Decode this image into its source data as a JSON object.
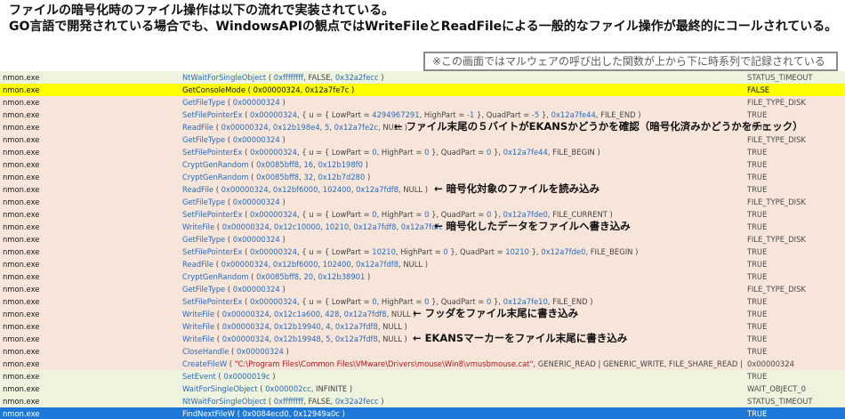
{
  "header": {
    "line1": "ファイルの暗号化時のファイル操作は以下の流れで実装されている。",
    "line2": "GO言語で開発されている場合でも、WindowsAPIの観点ではWriteFileとReadFileによる一般的なファイル操作が最終的にコールされている。"
  },
  "note": "※この画面ではマルウェアの呼び出した関数が上から下に時系列で記録されている",
  "rows": [
    {
      "process": "nmon.exe",
      "func": "NtWaitForSingleObject",
      "args": "( 0xffffffff, FALSE, 0x32a2fecc )",
      "result": "STATUS_TIMEOUT",
      "color": "green"
    },
    {
      "process": "nmon.exe",
      "func": "GetConsoleMode",
      "args": "( 0x00000324, 0x12a7fe7c )",
      "result": "FALSE",
      "color": "yellow"
    },
    {
      "process": "nmon.exe",
      "func": "GetFileType",
      "args": "( 0x00000324 )",
      "result": "FILE_TYPE_DISK",
      "color": "peach"
    },
    {
      "process": "nmon.exe",
      "func": "SetFilePointerEx",
      "args": "( 0x00000324, { u = { LowPart = 4294967291, HighPart = -1 }, QuadPart = -5 }, 0x12a7fe44, FILE_END )",
      "result": "TRUE",
      "color": "peach"
    },
    {
      "process": "nmon.exe",
      "func": "ReadFile",
      "args": "( 0x00000324, 0x12b198e4, 5, 0x12a7fe2c, NULL )",
      "result": "TRUE",
      "color": "peach"
    },
    {
      "process": "nmon.exe",
      "func": "GetFileType",
      "args": "( 0x00000324 )",
      "result": "FILE_TYPE_DISK",
      "color": "peach"
    },
    {
      "process": "nmon.exe",
      "func": "SetFilePointerEx",
      "args": "( 0x00000324, { u = { LowPart = 0, HighPart = 0 }, QuadPart = 0 }, 0x12a7fe44, FILE_BEGIN )",
      "result": "TRUE",
      "color": "peach"
    },
    {
      "process": "nmon.exe",
      "func": "CryptGenRandom",
      "args": "( 0x0085bff8, 16, 0x12b198f0 )",
      "result": "TRUE",
      "color": "peach"
    },
    {
      "process": "nmon.exe",
      "func": "CryptGenRandom",
      "args": "( 0x0085bff8, 32, 0x12b7d280 )",
      "result": "TRUE",
      "color": "peach"
    },
    {
      "process": "nmon.exe",
      "func": "ReadFile",
      "args": "( 0x00000324, 0x12bf6000, 102400, 0x12a7fdf8, NULL )",
      "result": "TRUE",
      "color": "peach"
    },
    {
      "process": "nmon.exe",
      "func": "GetFileType",
      "args": "( 0x00000324 )",
      "result": "FILE_TYPE_DISK",
      "color": "peach"
    },
    {
      "process": "nmon.exe",
      "func": "SetFilePointerEx",
      "args": "( 0x00000324, { u = { LowPart = 0, HighPart = 0 }, QuadPart = 0 }, 0x12a7fde0, FILE_CURRENT )",
      "result": "TRUE",
      "color": "peach"
    },
    {
      "process": "nmon.exe",
      "func": "WriteFile",
      "args": "( 0x00000324, 0x12c10000, 10210, 0x12a7fdf8, 0x12a7fdfc )",
      "result": "TRUE",
      "color": "peach"
    },
    {
      "process": "nmon.exe",
      "func": "GetFileType",
      "args": "( 0x00000324 )",
      "result": "FILE_TYPE_DISK",
      "color": "peach"
    },
    {
      "process": "nmon.exe",
      "func": "SetFilePointerEx",
      "args": "( 0x00000324, { u = { LowPart = 10210, HighPart = 0 }, QuadPart = 10210 }, 0x12a7fde0, FILE_BEGIN )",
      "result": "TRUE",
      "color": "peach"
    },
    {
      "process": "nmon.exe",
      "func": "ReadFile",
      "args": "( 0x00000324, 0x12bf6000, 102400, 0x12a7fdf8, NULL )",
      "result": "TRUE",
      "color": "peach"
    },
    {
      "process": "nmon.exe",
      "func": "CryptGenRandom",
      "args": "( 0x0085bff8, 20, 0x12b38901 )",
      "result": "TRUE",
      "color": "peach"
    },
    {
      "process": "nmon.exe",
      "func": "GetFileType",
      "args": "( 0x00000324 )",
      "result": "FILE_TYPE_DISK",
      "color": "peach"
    },
    {
      "process": "nmon.exe",
      "func": "SetFilePointerEx",
      "args": "( 0x00000324, { u = { LowPart = 0, HighPart = 0 }, QuadPart = 0 }, 0x12a7fe10, FILE_END )",
      "result": "TRUE",
      "color": "peach"
    },
    {
      "process": "nmon.exe",
      "func": "WriteFile",
      "args": "( 0x00000324, 0x12c1a600, 428, 0x12a7fdf8, NULL )",
      "result": "TRUE",
      "color": "peach"
    },
    {
      "process": "nmon.exe",
      "func": "WriteFile",
      "args": "( 0x00000324, 0x12b19940, 4, 0x12a7fdf8, NULL )",
      "result": "TRUE",
      "color": "peach"
    },
    {
      "process": "nmon.exe",
      "func": "WriteFile",
      "args": "( 0x00000324, 0x12b19948, 5, 0x12a7fdf8, NULL )",
      "result": "TRUE",
      "color": "peach"
    },
    {
      "process": "nmon.exe",
      "func": "CloseHandle",
      "args": "( 0x00000324 )",
      "result": "TRUE",
      "color": "peach"
    },
    {
      "process": "nmon.exe",
      "func": "CreateFileW",
      "args": "( \"C:\\Program Files\\Common Files\\VMware\\Drivers\\mouse\\Win8\\vmusbmouse.cat\", GENERIC_READ | GENERIC_WRITE, FILE_SHARE_READ | FILE_SHAR...",
      "result": "0x00000324",
      "color": "peach"
    },
    {
      "process": "nmon.exe",
      "func": "SetEvent",
      "args": "( 0x0000019c )",
      "result": "TRUE",
      "color": "green"
    },
    {
      "process": "nmon.exe",
      "func": "WaitForSingleObject",
      "args": "( 0x000002cc, INFINITE )",
      "result": "WAIT_OBJECT_0",
      "color": "green"
    },
    {
      "process": "nmon.exe",
      "func": "NtWaitForSingleObject",
      "args": "( 0xffffffff, FALSE, 0x32a2fecc )",
      "result": "STATUS_TIMEOUT",
      "color": "green"
    },
    {
      "process": "nmon.exe",
      "func": "FindNextFileW",
      "args": "( 0x0084ecd0, 0x12949a0c )",
      "result": "TRUE",
      "color": "blue"
    }
  ],
  "annotations": [
    {
      "row": 4,
      "text": "← ファイル末尾の５バイトがEKANSかどうかを確認（暗号化済みかどうかをチェック）"
    },
    {
      "row": 9,
      "text": "← 暗号化対象のファイルを読み込み"
    },
    {
      "row": 12,
      "text": "← 暗号化したデータをファイルへ書き込み"
    },
    {
      "row": 19,
      "text": "← フッダをファイル末尾に書き込み"
    },
    {
      "row": 21,
      "text": "← EKANSマーカーをファイル末尾に書き込み"
    }
  ]
}
